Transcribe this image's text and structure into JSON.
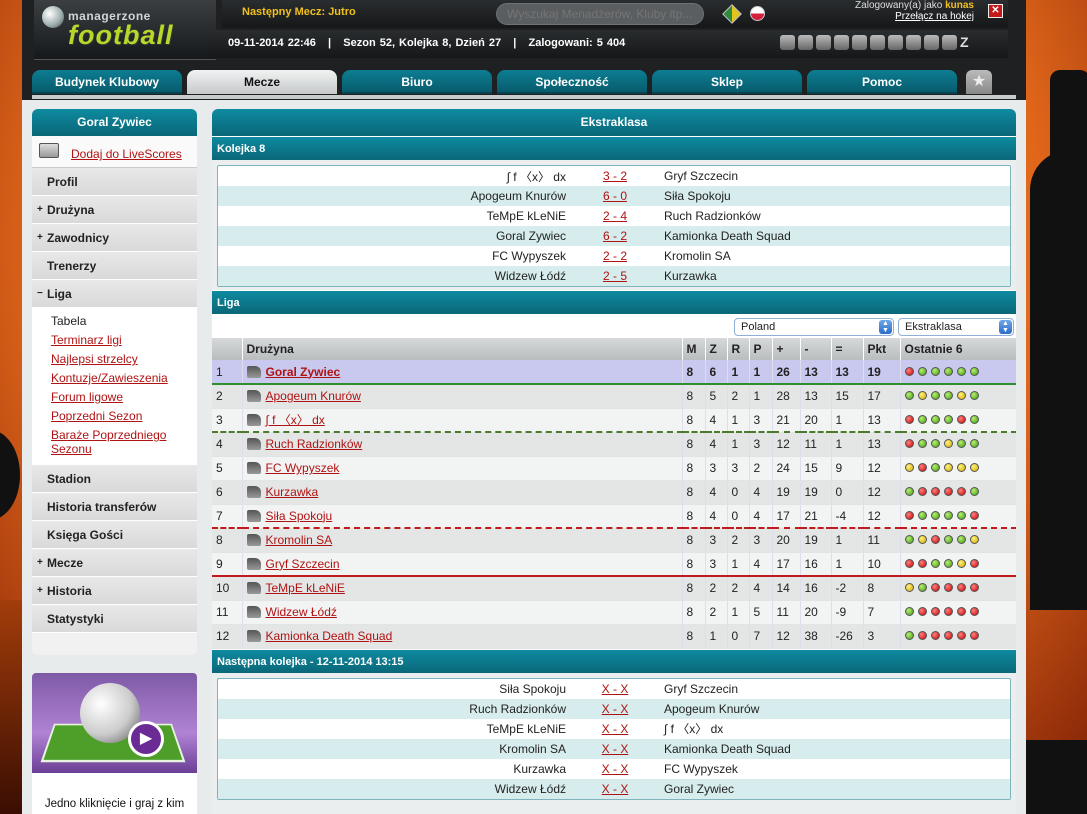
{
  "header": {
    "logo_top": "managerzone",
    "logo_main": "football",
    "next_match": "Następny Mecz: Jutro",
    "search_placeholder": "Wyszukaj Menadżerów, Kluby itp...",
    "logged_prefix": "Zalogowany(a) jako",
    "username": "kunas",
    "switch_link": "Przełącz na hokej",
    "close": "✕",
    "info_line": "09-11-2014 22:46   |   Sezon 52, Kolejka 8, Dzień 27   |   Zalogowani: 5 404"
  },
  "nav": {
    "tabs": [
      "Budynek Klubowy",
      "Mecze",
      "Biuro",
      "Społeczność",
      "Sklep",
      "Pomoc"
    ],
    "active": "Mecze",
    "fav": "★"
  },
  "sidebar": {
    "title": "Goral Zywiec",
    "live": "Dodaj do LiveScores",
    "items": [
      {
        "label": "Profil",
        "prefix": ""
      },
      {
        "label": "Drużyna",
        "prefix": "+"
      },
      {
        "label": "Zawodnicy",
        "prefix": "+"
      },
      {
        "label": "Trenerzy",
        "prefix": ""
      },
      {
        "label": "Liga",
        "prefix": "−"
      }
    ],
    "liga_sub": {
      "current": "Tabela",
      "links": [
        "Terminarz ligi",
        "Najlepsi strzelcy",
        "Kontuzje/Zawieszenia",
        "Forum ligowe",
        "Poprzedni Sezon",
        "Baraże Poprzedniego Sezonu"
      ]
    },
    "items2": [
      {
        "label": "Stadion",
        "prefix": ""
      },
      {
        "label": "Historia transferów",
        "prefix": ""
      },
      {
        "label": "Księga Gości",
        "prefix": ""
      },
      {
        "label": "Mecze",
        "prefix": "+"
      },
      {
        "label": "Historia",
        "prefix": "+"
      },
      {
        "label": "Statystyki",
        "prefix": ""
      }
    ]
  },
  "promo": {
    "text": "Jedno kliknięcie i graj z kim",
    "play": "▶"
  },
  "main": {
    "title": "Ekstraklasa",
    "round_title": "Kolejka 8",
    "round_matches": [
      {
        "home": "∫ f 〈x〉 dx",
        "score": "3 - 2",
        "away": "Gryf Szczecin"
      },
      {
        "home": "Apogeum Knurów",
        "score": "6 - 0",
        "away": "Siła Spokoju"
      },
      {
        "home": "TeMpE kLeNiE",
        "score": "2 - 4",
        "away": "Ruch Radzionków"
      },
      {
        "home": "Goral Zywiec",
        "score": "6 - 2",
        "away": "Kamionka Death Squad"
      },
      {
        "home": "FC Wypyszek",
        "score": "2 - 2",
        "away": "Kromolin SA"
      },
      {
        "home": "Widzew Łódź",
        "score": "2 - 5",
        "away": "Kurzawka"
      }
    ],
    "league_title": "Liga",
    "country_select": "Poland",
    "league_select": "Ekstraklasa",
    "table_headers": [
      "",
      "Drużyna",
      "M",
      "Z",
      "R",
      "P",
      "+",
      "-",
      "=",
      "Pkt",
      "Ostatnie 6"
    ],
    "table": [
      {
        "pos": "1",
        "team": "Goral Zywiec",
        "m": "8",
        "z": "6",
        "r": "1",
        "p": "1",
        "plus": "26",
        "minus": "13",
        "diff": "13",
        "pkt": "19",
        "form": [
          "r",
          "g",
          "g",
          "g",
          "g",
          "g"
        ]
      },
      {
        "pos": "2",
        "team": "Apogeum Knurów",
        "m": "8",
        "z": "5",
        "r": "2",
        "p": "1",
        "plus": "28",
        "minus": "13",
        "diff": "15",
        "pkt": "17",
        "form": [
          "g",
          "y",
          "g",
          "g",
          "y",
          "g"
        ]
      },
      {
        "pos": "3",
        "team": "∫ f 〈x〉 dx",
        "m": "8",
        "z": "4",
        "r": "1",
        "p": "3",
        "plus": "21",
        "minus": "20",
        "diff": "1",
        "pkt": "13",
        "form": [
          "r",
          "g",
          "g",
          "g",
          "r",
          "g"
        ]
      },
      {
        "pos": "4",
        "team": "Ruch Radzionków",
        "m": "8",
        "z": "4",
        "r": "1",
        "p": "3",
        "plus": "12",
        "minus": "11",
        "diff": "1",
        "pkt": "13",
        "form": [
          "r",
          "g",
          "g",
          "y",
          "g",
          "g"
        ]
      },
      {
        "pos": "5",
        "team": "FC Wypyszek",
        "m": "8",
        "z": "3",
        "r": "3",
        "p": "2",
        "plus": "24",
        "minus": "15",
        "diff": "9",
        "pkt": "12",
        "form": [
          "y",
          "r",
          "g",
          "y",
          "y",
          "y"
        ]
      },
      {
        "pos": "6",
        "team": "Kurzawka",
        "m": "8",
        "z": "4",
        "r": "0",
        "p": "4",
        "plus": "19",
        "minus": "19",
        "diff": "0",
        "pkt": "12",
        "form": [
          "g",
          "r",
          "r",
          "r",
          "r",
          "g"
        ]
      },
      {
        "pos": "7",
        "team": "Siła Spokoju",
        "m": "8",
        "z": "4",
        "r": "0",
        "p": "4",
        "plus": "17",
        "minus": "21",
        "diff": "-4",
        "pkt": "12",
        "form": [
          "r",
          "g",
          "g",
          "g",
          "g",
          "r"
        ]
      },
      {
        "pos": "8",
        "team": "Kromolin SA",
        "m": "8",
        "z": "3",
        "r": "2",
        "p": "3",
        "plus": "20",
        "minus": "19",
        "diff": "1",
        "pkt": "11",
        "form": [
          "g",
          "y",
          "r",
          "g",
          "g",
          "y"
        ]
      },
      {
        "pos": "9",
        "team": "Gryf Szczecin",
        "m": "8",
        "z": "3",
        "r": "1",
        "p": "4",
        "plus": "17",
        "minus": "16",
        "diff": "1",
        "pkt": "10",
        "form": [
          "r",
          "r",
          "g",
          "g",
          "y",
          "r"
        ]
      },
      {
        "pos": "10",
        "team": "TeMpE kLeNiE",
        "m": "8",
        "z": "2",
        "r": "2",
        "p": "4",
        "plus": "14",
        "minus": "16",
        "diff": "-2",
        "pkt": "8",
        "form": [
          "y",
          "g",
          "r",
          "r",
          "r",
          "r"
        ]
      },
      {
        "pos": "11",
        "team": "Widzew Łódź",
        "m": "8",
        "z": "2",
        "r": "1",
        "p": "5",
        "plus": "11",
        "minus": "20",
        "diff": "-9",
        "pkt": "7",
        "form": [
          "g",
          "r",
          "r",
          "r",
          "r",
          "r"
        ]
      },
      {
        "pos": "12",
        "team": "Kamionka Death Squad",
        "m": "8",
        "z": "1",
        "r": "0",
        "p": "7",
        "plus": "12",
        "minus": "38",
        "diff": "-26",
        "pkt": "3",
        "form": [
          "g",
          "r",
          "r",
          "r",
          "r",
          "r"
        ]
      }
    ],
    "next_title": "Następna kolejka - 12-11-2014 13:15",
    "next_matches": [
      {
        "home": "Siła Spokoju",
        "score": "X - X",
        "away": "Gryf Szczecin"
      },
      {
        "home": "Ruch Radzionków",
        "score": "X - X",
        "away": "Apogeum Knurów"
      },
      {
        "home": "TeMpE kLeNiE",
        "score": "X - X",
        "away": "∫ f 〈x〉 dx"
      },
      {
        "home": "Kromolin SA",
        "score": "X - X",
        "away": "Kamionka Death Squad"
      },
      {
        "home": "Kurzawka",
        "score": "X - X",
        "away": "FC Wypyszek"
      },
      {
        "home": "Widzew Łódź",
        "score": "X - X",
        "away": "Goral Zywiec"
      }
    ]
  },
  "colors": {
    "accent_teal": "#0a6778",
    "link_red": "#b01313",
    "highlight_row": "#c9c8ee",
    "logo_green": "#b7d82a",
    "header_yellow": "#f0c020"
  }
}
